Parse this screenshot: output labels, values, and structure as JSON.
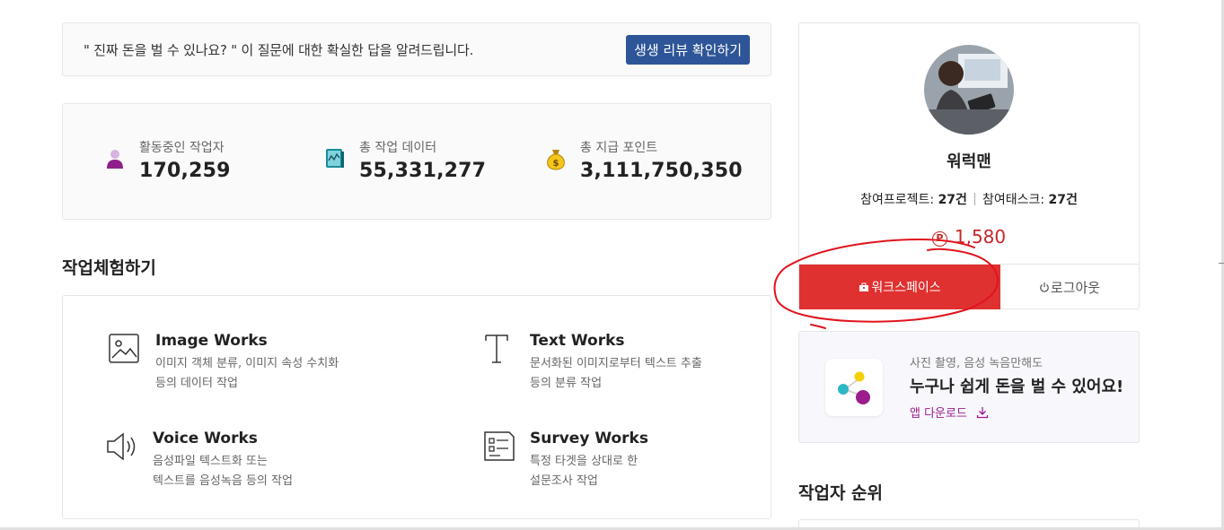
{
  "banner": {
    "text": "\" 진짜 돈을 벌 수 있나요? \" 이 질문에 대한 확실한 답을 알려드립니다.",
    "button_label": "생생 리뷰 확인하기"
  },
  "stats": [
    {
      "label": "활동중인 작업자",
      "value": "170,259",
      "icon": "user-icon"
    },
    {
      "label": "총 작업 데이터",
      "value": "55,331,277",
      "icon": "data-book-icon"
    },
    {
      "label": "총 지급 포인트",
      "value": "3,111,750,350",
      "icon": "money-bag-icon"
    }
  ],
  "experience": {
    "title": "작업체험하기",
    "items": [
      {
        "title": "Image Works",
        "desc1": "이미지 객체 분류, 이미지 속성 수치화",
        "desc2": "등의 데이터 작업",
        "icon": "image-icon"
      },
      {
        "title": "Text Works",
        "desc1": "문서화된 이미지로부터 텍스트 추출",
        "desc2": "등의 분류 작업",
        "icon": "text-icon"
      },
      {
        "title": "Voice Works",
        "desc1": "음성파일 텍스트화 또는",
        "desc2": "텍스트를 음성녹음 등의 작업",
        "icon": "speaker-icon"
      },
      {
        "title": "Survey Works",
        "desc1": "특정 타겟을 상대로 한",
        "desc2": "설문조사 작업",
        "icon": "survey-icon"
      }
    ]
  },
  "profile": {
    "username": "워럭맨",
    "project_label": "참여프로젝트: ",
    "project_count": "27건",
    "task_label": "참여태스크: ",
    "task_count": "27건",
    "points_symbol": "P",
    "points": "1,580",
    "workspace_label": "워크스페이스",
    "logout_label": "로그아웃"
  },
  "app_promo": {
    "subtitle": "사진 촬영, 음성 녹음만해도",
    "headline": "누구나 쉽게 돈을 벌 수 있어요!",
    "link_label": "앱 다운로드"
  },
  "ranking": {
    "title": "작업자 순위"
  },
  "colors": {
    "primary_blue": "#2e5597",
    "workspace_red": "#e03131",
    "points_red": "#c62828",
    "accent_purple": "#9c1c8c",
    "annotation_red": "#e0141e"
  }
}
